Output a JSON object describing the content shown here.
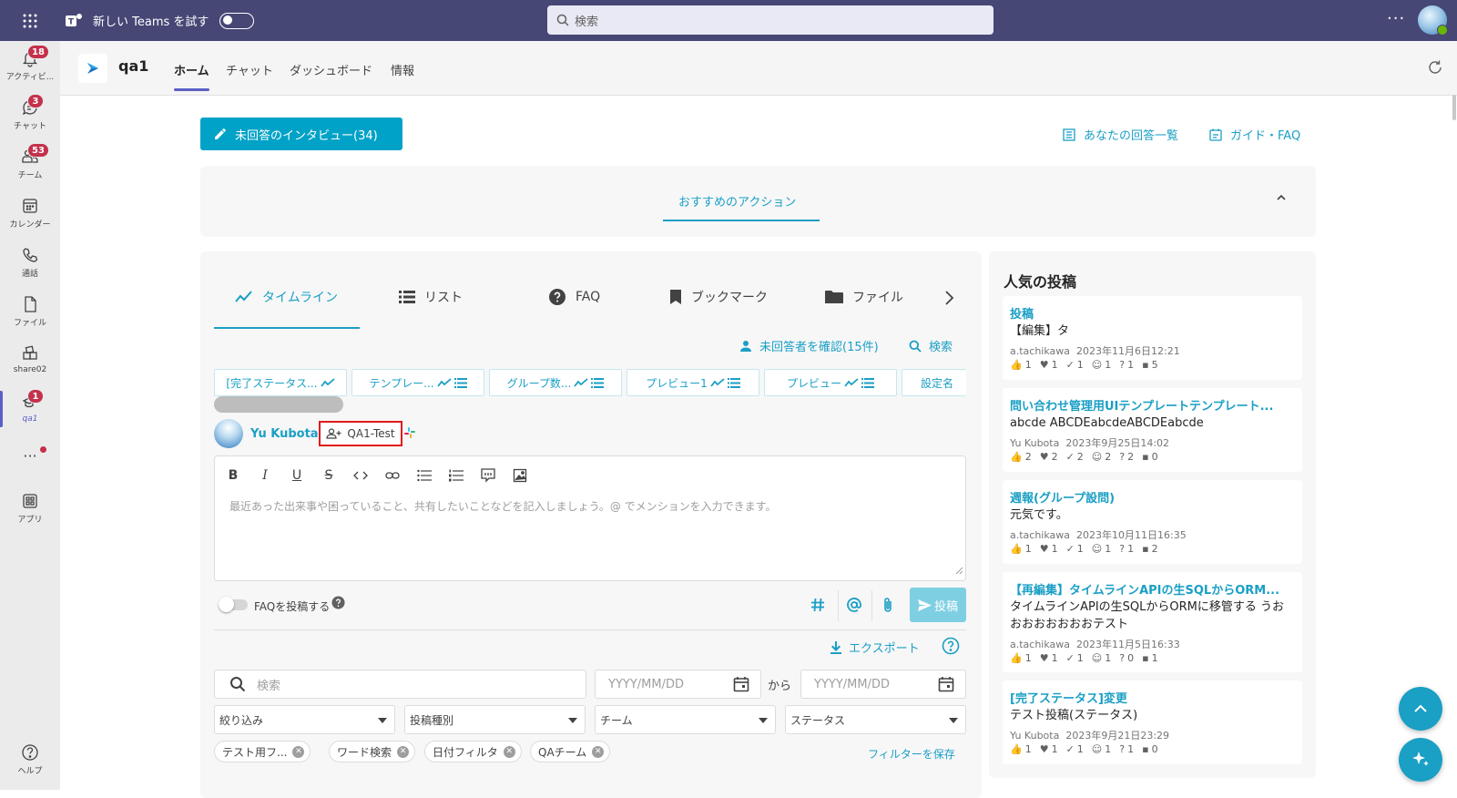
{
  "topbar": {
    "new_teams_label": "新しい Teams を試す",
    "search_placeholder": "検索",
    "more_label": "···"
  },
  "rail": [
    {
      "label": "アクティビ...",
      "icon": "bell-icon",
      "badge": "18"
    },
    {
      "label": "チャット",
      "icon": "chat-icon",
      "badge": "3"
    },
    {
      "label": "チーム",
      "icon": "teams-icon",
      "badge": "53"
    },
    {
      "label": "カレンダー",
      "icon": "calendar-icon",
      "badge": ""
    },
    {
      "label": "通話",
      "icon": "phone-icon",
      "badge": ""
    },
    {
      "label": "ファイル",
      "icon": "file-icon",
      "badge": ""
    },
    {
      "label": "share02",
      "icon": "app-icon",
      "badge": ""
    },
    {
      "label": "qa1",
      "icon": "qa-app-icon",
      "badge": "1"
    },
    {
      "label": "···",
      "icon": "more-icon",
      "badge": ""
    },
    {
      "label": "アプリ",
      "icon": "apps-icon",
      "badge": ""
    },
    {
      "label": "ヘルプ",
      "icon": "help-icon",
      "badge": ""
    }
  ],
  "header": {
    "app_name": "qa1",
    "tabs": [
      "ホーム",
      "チャット",
      "ダッシュボード",
      "情報"
    ],
    "active_tab": "ホーム"
  },
  "main": {
    "unanswered_button": "未回答のインタビュー(34)",
    "your_answers_link": "あなたの回答一覧",
    "guide_link": "ガイド・FAQ",
    "recommended_actions": "おすすめのアクション"
  },
  "timeline": {
    "tabs": [
      "タイムライン",
      "リスト",
      "FAQ",
      "ブックマーク",
      "ファイル"
    ],
    "check_unanswered": "未回答者を確認(15件)",
    "search_label": "検索",
    "chips": [
      "[完了ステータス...",
      "テンプレー...",
      "グループ数...",
      "プレビュー1",
      "プレビュー",
      "設定名"
    ],
    "user_name": "Yu Kubota",
    "group_name": "QA1-Test",
    "editor_placeholder": "最近あった出来事や困っていること、共有したいことなどを記入しましょう。@ でメンションを入力できます。",
    "toolbar": [
      "B",
      "I",
      "U",
      "S"
    ],
    "faq_toggle_label": "FAQを投稿する",
    "post_button": "投稿",
    "export_label": "エクスポート"
  },
  "filters": {
    "search_placeholder": "検索",
    "date_from_placeholder": "YYYY/MM/DD",
    "from_label": "から",
    "date_to_placeholder": "YYYY/MM/DD",
    "selects": [
      "絞り込み",
      "投稿種別",
      "チーム",
      "ステータス"
    ],
    "tags": [
      "テスト用フ...",
      "ワード検索",
      "日付フィルタ",
      "QAチーム"
    ],
    "save_filter": "フィルターを保存"
  },
  "popular": {
    "title": "人気の投稿",
    "posts": [
      {
        "title": "投稿",
        "body": "【編集】タ",
        "author": "a.tachikawa",
        "date": "2023年11月6日12:21",
        "stats": [
          "1",
          "1",
          "1",
          "1",
          "1",
          "5"
        ]
      },
      {
        "title": "問い合わせ管理用UIテンプレートテンプレート...",
        "body": "abcde ABCDEabcdeABCDEabcde",
        "author": "Yu Kubota",
        "date": "2023年9月25日14:02",
        "stats": [
          "2",
          "2",
          "2",
          "2",
          "2",
          "0"
        ]
      },
      {
        "title": "週報(グループ設問)",
        "body": "元気です。",
        "author": "a.tachikawa",
        "date": "2023年10月11日16:35",
        "stats": [
          "1",
          "1",
          "1",
          "1",
          "1",
          "2"
        ]
      },
      {
        "title": "【再編集】タイムラインAPIの生SQLからORM...",
        "body": "タイムラインAPIの生SQLからORMに移管する うおおおおおおおおテスト",
        "author": "a.tachikawa",
        "date": "2023年11月5日16:33",
        "stats": [
          "1",
          "1",
          "1",
          "1",
          "0",
          "1"
        ]
      },
      {
        "title": "[完了ステータス]変更",
        "body": "テスト投稿(ステータス)",
        "author": "Yu Kubota",
        "date": "2023年9月21日23:29",
        "stats": [
          "1",
          "1",
          "1",
          "1",
          "1",
          "0"
        ]
      }
    ]
  },
  "colors": {
    "teams_purple": "#464775",
    "accent": "#1a9fc5",
    "badge_red": "#c4314b"
  }
}
